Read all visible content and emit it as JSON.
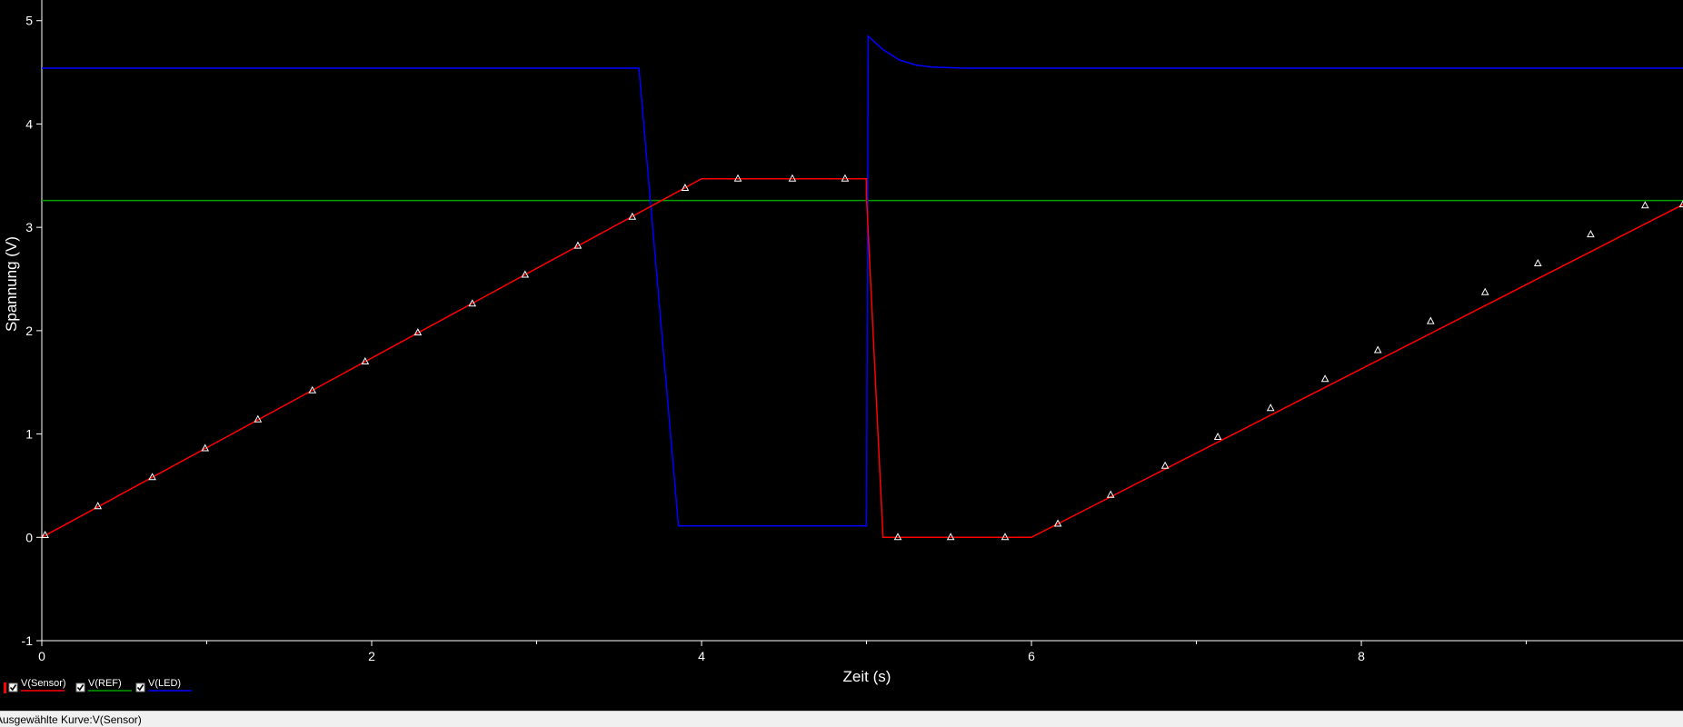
{
  "status_bar": {
    "text": "Ausgewählte Kurve:V(Sensor)"
  },
  "chart_data": {
    "type": "line",
    "title": "",
    "xlabel": "Zeit (s)",
    "ylabel": "Spannung (V)",
    "xlim": [
      0,
      9.95
    ],
    "ylim": [
      -1,
      5.2
    ],
    "x_ticks": [
      0,
      2,
      4,
      6,
      8
    ],
    "y_ticks": [
      -1,
      0,
      1,
      2,
      3,
      4,
      5
    ],
    "grid": false,
    "background": "#000000",
    "axis_color": "#ffffff",
    "legend_position": "bottom-left",
    "legend": [
      {
        "name": "V(Sensor)",
        "color": "#ff0000",
        "checked": true
      },
      {
        "name": "V(REF)",
        "color": "#00a000",
        "checked": true
      },
      {
        "name": "V(LED)",
        "color": "#0000ff",
        "checked": true
      }
    ],
    "series": [
      {
        "name": "V(Sensor)",
        "color": "#ff0000",
        "marker": "triangle",
        "x": [
          0,
          4.0,
          5.0,
          5.0,
          5.1,
          6.0,
          9.95
        ],
        "y": [
          0,
          3.47,
          3.47,
          3.3,
          0,
          0,
          3.22
        ],
        "marker_x": [
          0.02,
          0.34,
          0.67,
          0.99,
          1.31,
          1.64,
          1.96,
          2.28,
          2.61,
          2.93,
          3.25,
          3.58,
          3.9,
          4.22,
          4.55,
          4.87,
          5.19,
          5.51,
          5.84,
          6.16,
          6.48,
          6.81,
          7.13,
          7.45,
          7.78,
          8.1,
          8.42,
          8.75,
          9.07,
          9.39,
          9.72,
          9.95
        ],
        "marker_y": [
          0.02,
          0.3,
          0.58,
          0.86,
          1.14,
          1.42,
          1.7,
          1.98,
          2.26,
          2.54,
          2.82,
          3.1,
          3.38,
          3.47,
          3.47,
          3.47,
          0,
          0,
          0,
          0.13,
          0.41,
          0.69,
          0.97,
          1.25,
          1.53,
          1.81,
          2.09,
          2.37,
          2.65,
          2.93,
          3.21,
          3.22
        ]
      },
      {
        "name": "V(REF)",
        "color": "#00a000",
        "x": [
          0,
          9.95
        ],
        "y": [
          3.26,
          3.26
        ]
      },
      {
        "name": "V(LED)",
        "color": "#0000ff",
        "x": [
          0,
          3.62,
          3.86,
          5.0,
          5.01,
          5.1,
          5.2,
          5.3,
          5.4,
          5.6,
          6.0,
          9.95
        ],
        "y": [
          4.54,
          4.54,
          0.11,
          0.11,
          4.85,
          4.72,
          4.62,
          4.57,
          4.55,
          4.54,
          4.54,
          4.54
        ]
      }
    ]
  }
}
